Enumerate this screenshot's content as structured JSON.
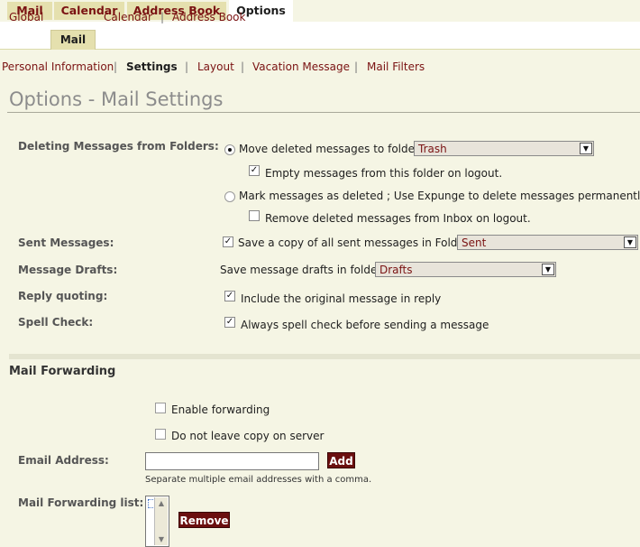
{
  "top_tabs": [
    "Mail",
    "Calendar",
    "Address Book",
    "Options"
  ],
  "sub_nav": [
    "Global",
    "Mail",
    "Calendar",
    "Address Book"
  ],
  "options_nav": [
    "Personal Information",
    "Settings",
    "Layout",
    "Vacation Message",
    "Mail Filters"
  ],
  "page_title": "Options - Mail Settings",
  "deleting": {
    "label": "Deleting Messages from Folders:",
    "move_option": "Move deleted messages to folder:",
    "move_folder": "Trash",
    "empty_on_logout": "Empty messages from this folder on logout.",
    "mark_option": "Mark messages as deleted ; Use Expunge to delete messages permanently.",
    "remove_on_logout": "Remove deleted messages from Inbox on logout."
  },
  "sent": {
    "label": "Sent Messages:",
    "text": "Save a copy of all sent messages in Folder:",
    "folder": "Sent"
  },
  "drafts": {
    "label": "Message Drafts:",
    "text": "Save message drafts in folder:",
    "folder": "Drafts"
  },
  "reply": {
    "label": "Reply quoting:",
    "text": "Include the original message in reply"
  },
  "spell": {
    "label": "Spell Check:",
    "text": "Always spell check before sending a message"
  },
  "forwarding": {
    "heading": "Mail Forwarding",
    "enable": "Enable forwarding",
    "no_copy": "Do not leave copy on server",
    "email_label": "Email Address:",
    "email_value": "",
    "add_button": "Add",
    "hint": "Separate multiple email addresses with a comma.",
    "list_label": "Mail Forwarding list:",
    "remove_button": "Remove"
  },
  "colors": {
    "background": "#f5f5e4",
    "tab": "#e5e0ae",
    "accent": "#7a1212",
    "button": "#6b0f0f"
  },
  "icons": [
    "checkmark-icon",
    "radio-dot-icon",
    "chevron-down-icon",
    "scroll-up-icon",
    "scroll-down-icon"
  ]
}
